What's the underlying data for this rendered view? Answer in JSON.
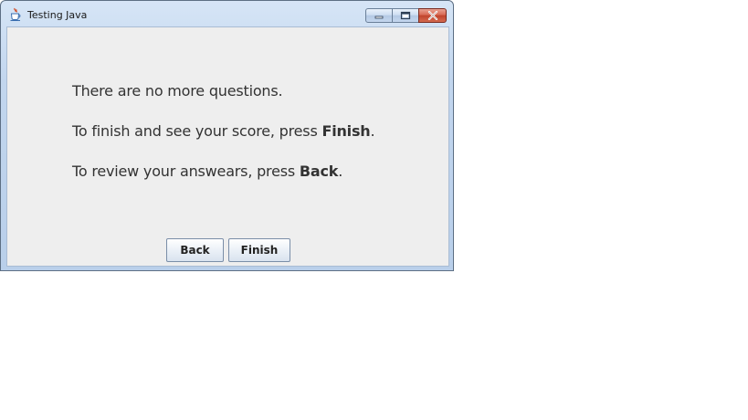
{
  "window": {
    "title": "Testing Java",
    "icon": "java-cup-icon",
    "controls": {
      "minimize_icon": "minimize-icon",
      "maximize_icon": "maximize-icon",
      "close_icon": "close-icon"
    }
  },
  "message": {
    "line1": "There are no more questions.",
    "line2_prefix": "To finish and see your score, press ",
    "line2_bold": "Finish",
    "line2_suffix": ".",
    "line3_prefix": "To review your answears, press ",
    "line3_bold": "Back",
    "line3_suffix": "."
  },
  "buttons": {
    "back_label": "Back",
    "finish_label": "Finish"
  },
  "colors": {
    "close_button": "#c0432c",
    "content_background": "#eeeeee",
    "frame_blue": "#b9cfea"
  }
}
